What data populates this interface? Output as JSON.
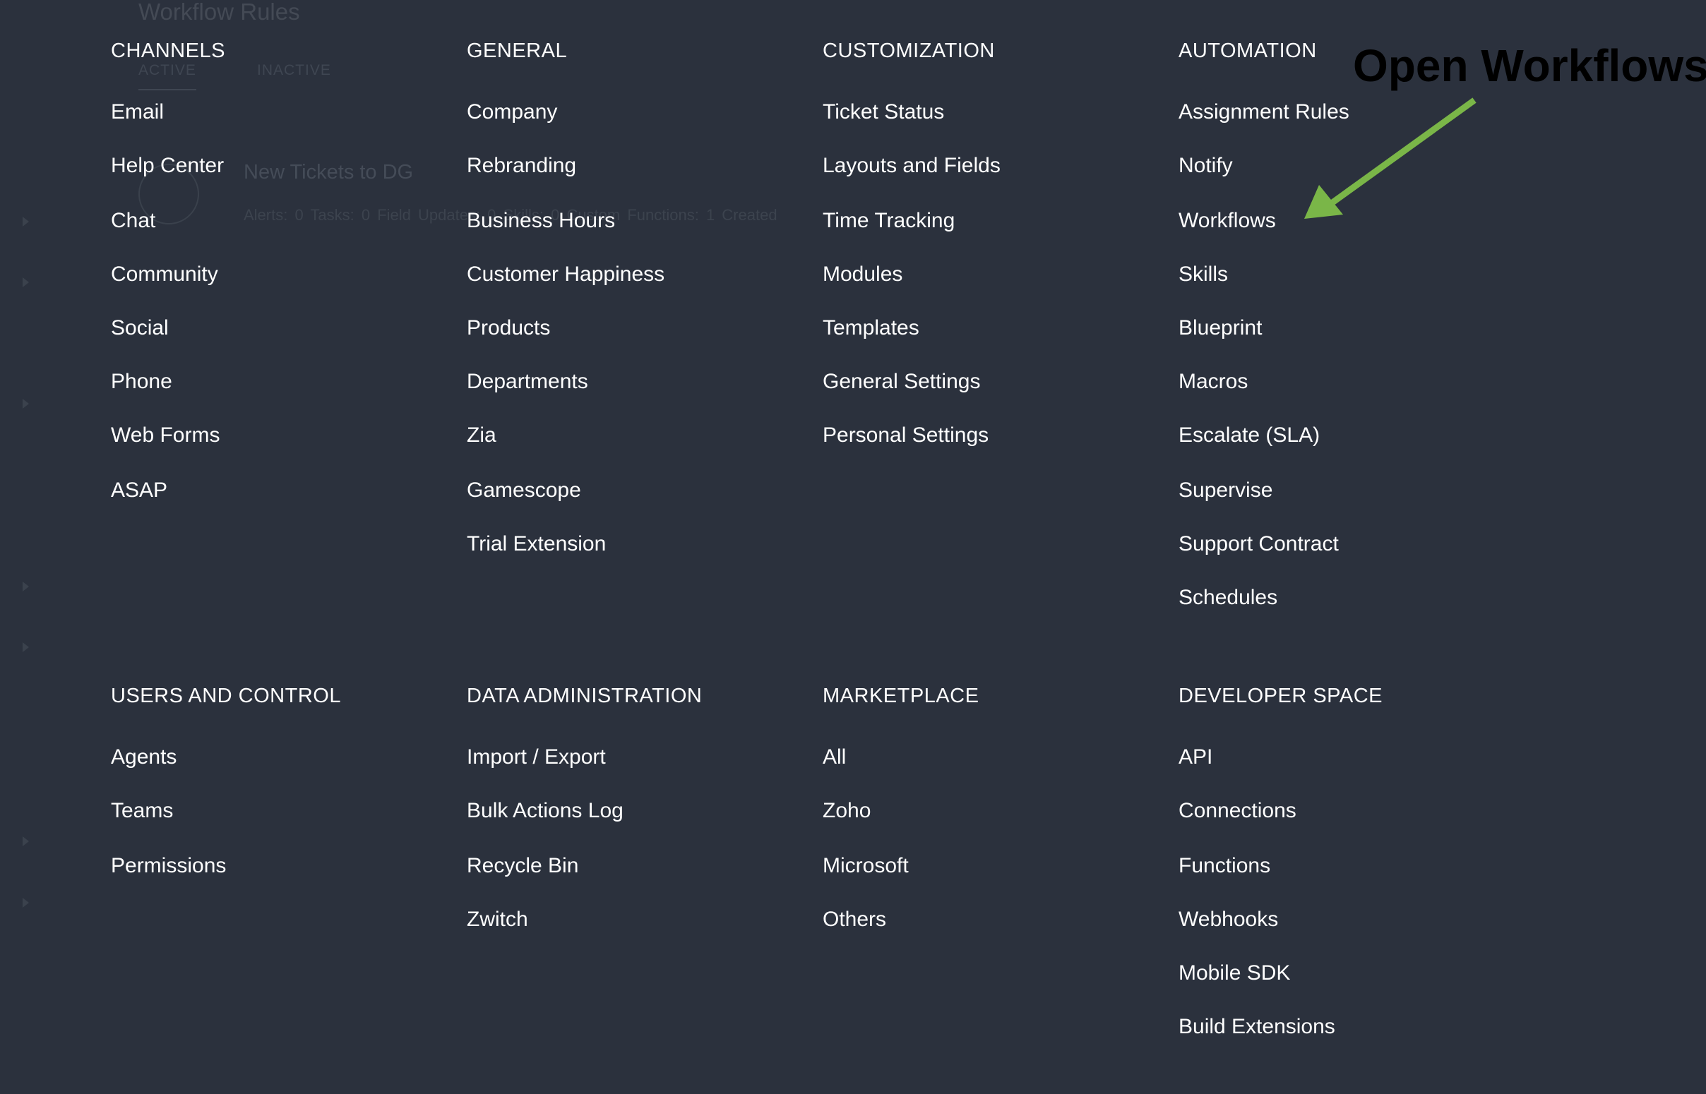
{
  "background": {
    "title": "Workflow Rules",
    "tabs": [
      "ACTIVE",
      "INACTIVE"
    ],
    "rule_name": "New Tickets to DG",
    "rule_stats": "Alerts: 0    Tasks: 0    Field Updates: 0    Skills: 0    Custom Functions: 1    Created"
  },
  "annotation": {
    "text": "Open Workflows",
    "arrow_color": "#7ab648"
  },
  "menu": {
    "channels": {
      "title": "CHANNELS",
      "items": [
        "Email",
        "Help Center",
        "Chat",
        "Community",
        "Social",
        "Phone",
        "Web Forms",
        "ASAP"
      ]
    },
    "general": {
      "title": "GENERAL",
      "items": [
        "Company",
        "Rebranding",
        "Business Hours",
        "Customer Happiness",
        "Products",
        "Departments",
        "Zia",
        "Gamescope",
        "Trial Extension"
      ]
    },
    "customization": {
      "title": "CUSTOMIZATION",
      "items": [
        "Ticket Status",
        "Layouts and Fields",
        "Time Tracking",
        "Modules",
        "Templates",
        "General Settings",
        "Personal Settings"
      ]
    },
    "automation": {
      "title": "AUTOMATION",
      "items": [
        "Assignment Rules",
        "Notify",
        "Workflows",
        "Skills",
        "Blueprint",
        "Macros",
        "Escalate (SLA)",
        "Supervise",
        "Support Contract",
        "Schedules"
      ]
    },
    "users_and_control": {
      "title": "USERS AND CONTROL",
      "items": [
        "Agents",
        "Teams",
        "Permissions"
      ]
    },
    "data_administration": {
      "title": "DATA ADMINISTRATION",
      "items": [
        "Import / Export",
        "Bulk Actions Log",
        "Recycle Bin",
        "Zwitch"
      ]
    },
    "marketplace": {
      "title": "MARKETPLACE",
      "items": [
        "All",
        "Zoho",
        "Microsoft",
        "Others"
      ]
    },
    "developer_space": {
      "title": "DEVELOPER SPACE",
      "items": [
        "API",
        "Connections",
        "Functions",
        "Webhooks",
        "Mobile SDK",
        "Build Extensions"
      ]
    }
  }
}
